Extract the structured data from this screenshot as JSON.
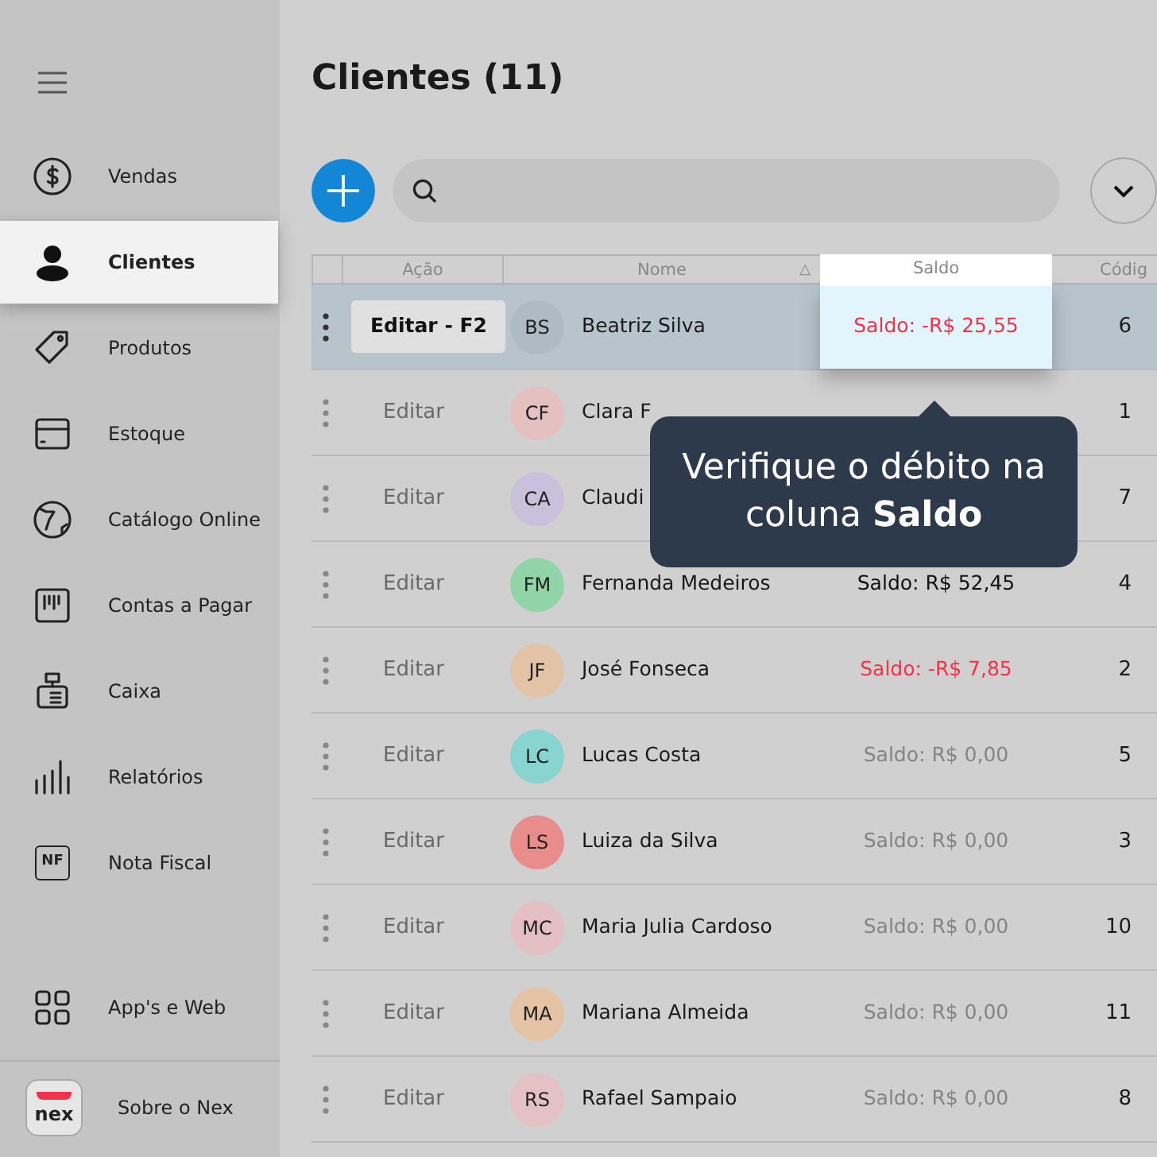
{
  "sidebar": {
    "items": [
      {
        "label": "Vendas",
        "selected": false
      },
      {
        "label": "Clientes",
        "selected": true
      },
      {
        "label": "Produtos",
        "selected": false
      },
      {
        "label": "Estoque",
        "selected": false
      },
      {
        "label": "Catálogo Online",
        "selected": false
      },
      {
        "label": "Contas a Pagar",
        "selected": false
      },
      {
        "label": "Caixa",
        "selected": false
      },
      {
        "label": "Relatórios",
        "selected": false
      },
      {
        "label": "Nota Fiscal",
        "selected": false,
        "icon_text": "NF"
      }
    ],
    "bottom_items": [
      {
        "label": "App's e Web"
      }
    ],
    "about": {
      "logo": "nex",
      "label": "Sobre o Nex"
    }
  },
  "page": {
    "title": "Clientes (11)"
  },
  "table": {
    "columns": [
      {
        "label": "Ação",
        "highlighted": false
      },
      {
        "label": "Nome",
        "sort": "△",
        "highlighted": false
      },
      {
        "label": "Saldo",
        "highlighted": true
      },
      {
        "label": "Códig",
        "highlighted": false
      }
    ],
    "rows": [
      {
        "selected": true,
        "action": "Editar - F2",
        "initials": "BS",
        "color": "#aebbc5",
        "name": "Beatriz Silva",
        "saldo": "Saldo: -R$ 25,55",
        "kind": "negative",
        "code": "6"
      },
      {
        "selected": false,
        "action": "Editar",
        "initials": "CF",
        "color": "#e4c0c0",
        "name": "Clara F",
        "code": "1"
      },
      {
        "selected": false,
        "action": "Editar",
        "initials": "CA",
        "color": "#c9c1dc",
        "name": "Claudi",
        "code": "7"
      },
      {
        "selected": false,
        "action": "Editar",
        "initials": "FM",
        "color": "#90d4a8",
        "name": "Fernanda Medeiros",
        "saldo": "Saldo: R$ 52,45",
        "kind": "positive",
        "code": "4"
      },
      {
        "selected": false,
        "action": "Editar",
        "initials": "JF",
        "color": "#e2c3a6",
        "name": "José Fonseca",
        "saldo": "Saldo: -R$ 7,85",
        "kind": "negative",
        "code": "2"
      },
      {
        "selected": false,
        "action": "Editar",
        "initials": "LC",
        "color": "#88d4d0",
        "name": "Lucas Costa",
        "saldo": "Saldo: R$ 0,00",
        "kind": "zero",
        "code": "5"
      },
      {
        "selected": false,
        "action": "Editar",
        "initials": "LS",
        "color": "#e88c8c",
        "name": "Luiza da Silva",
        "saldo": "Saldo: R$ 0,00",
        "kind": "zero",
        "code": "3"
      },
      {
        "selected": false,
        "action": "Editar",
        "initials": "MC",
        "color": "#e4c0c4",
        "name": "Maria Julia Cardoso",
        "saldo": "Saldo: R$ 0,00",
        "kind": "zero",
        "code": "10"
      },
      {
        "selected": false,
        "action": "Editar",
        "initials": "MA",
        "color": "#e4c4a4",
        "name": "Mariana Almeida",
        "saldo": "Saldo: R$ 0,00",
        "kind": "zero",
        "code": "11"
      },
      {
        "selected": false,
        "action": "Editar",
        "initials": "RS",
        "color": "#e3c1c5",
        "name": "Rafael Sampaio",
        "saldo": "Saldo: R$ 0,00",
        "kind": "zero",
        "code": "8"
      }
    ]
  },
  "tooltip": {
    "text": "Verifique o débito na coluna **Saldo**"
  }
}
